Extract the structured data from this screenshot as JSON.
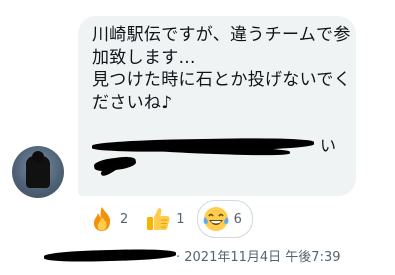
{
  "message": {
    "text": "川崎駅伝ですが、違うチームで参加致します…\n見つけた時に石とか投げないでくださいね♪",
    "trailing_glyph": "い"
  },
  "reactions": [
    {
      "icon": "fire-emoji",
      "count": "2"
    },
    {
      "icon": "thumbs-up-emoji",
      "count": "1"
    },
    {
      "icon": "laughing-tears-emoji",
      "count": "6",
      "selected": true
    }
  ],
  "meta": {
    "timestamp": "· 2021年11月4日 午後7:39"
  },
  "colors": {
    "bubble": "#eff3f4",
    "text": "#0f1419",
    "muted": "#536471"
  }
}
